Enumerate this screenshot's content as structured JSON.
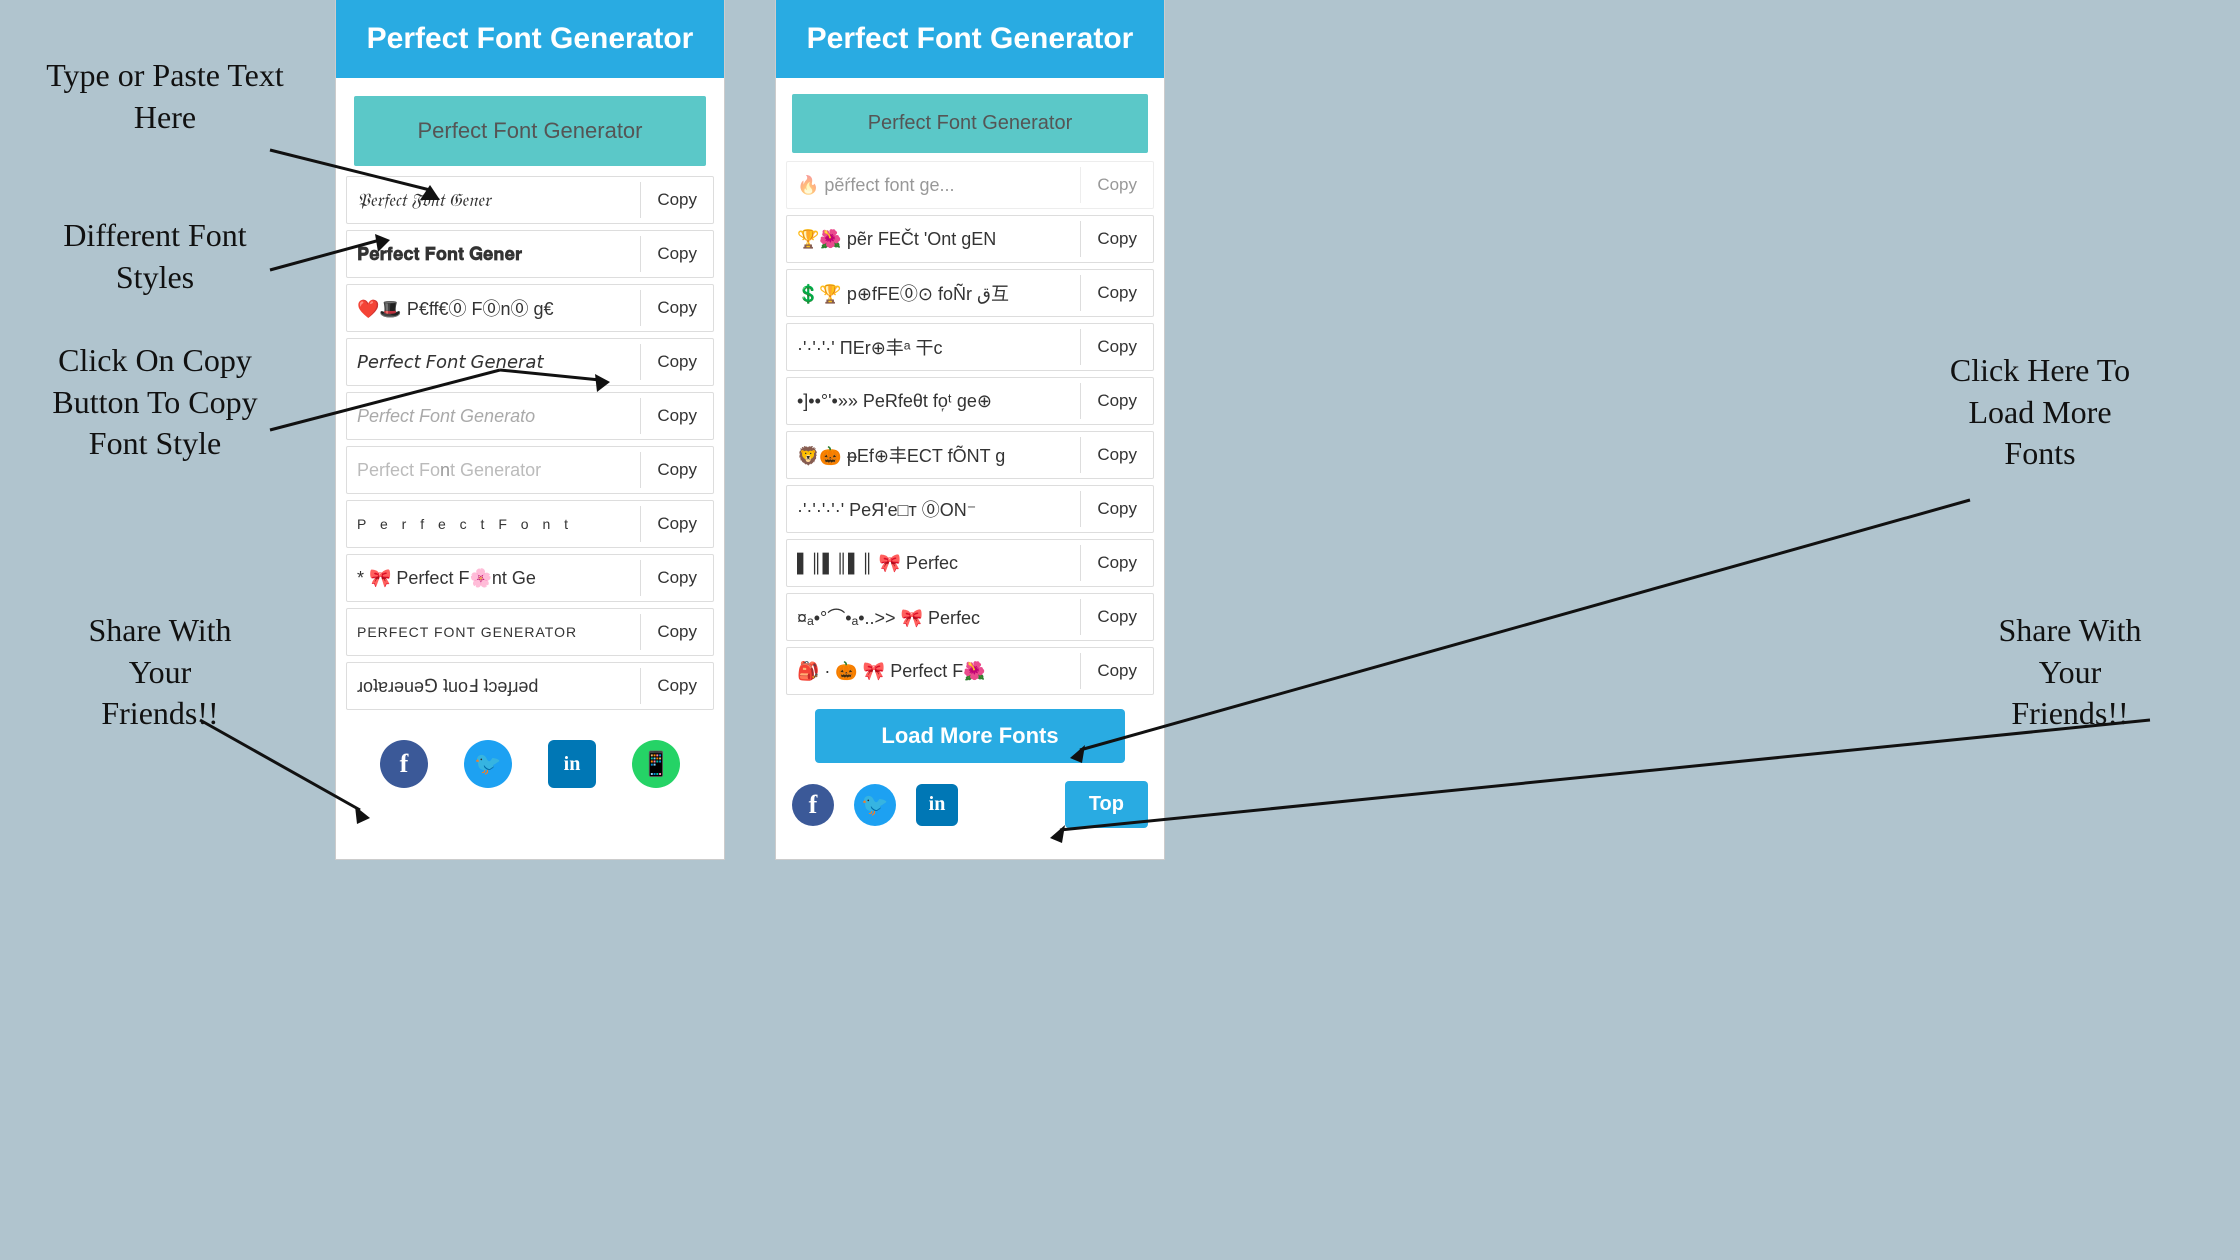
{
  "annotations": {
    "type_paste": "Type or Paste Text\nHere",
    "diff_fonts": "Different Font\nStyles",
    "click_copy": "Click On Copy\nButton To Copy\nFont Style",
    "share": "Share With\nYour\nFriends!!",
    "load_more": "Click Here To\nLoad More\nFonts",
    "share2": "Share With\nYour\nFriends!!"
  },
  "left_panel": {
    "header": "Perfect Font Generator",
    "input_placeholder": "Perfect Font Generator",
    "fonts": [
      {
        "text": "𝔓𝔢𝔯𝔣𝔢𝔠𝔱 𝔉𝔬𝔫𝔱 𝔊𝔢𝔫𝔢𝔯𝔞𝔱𝔬𝔯",
        "copy": "Copy",
        "style": ""
      },
      {
        "text": "𝐏𝐞𝐫𝐟𝐞𝐜𝐭 𝐅𝐨𝐧𝐭 𝐆𝐞𝐧𝐞𝐫𝐚𝐭𝐨𝐫",
        "copy": "Copy",
        "style": ""
      },
      {
        "text": "❤️🎩 P€ff€⓪ F⓪n⓪ g€",
        "copy": "Copy",
        "style": ""
      },
      {
        "text": "𝘗𝘦𝘳𝘧𝘦𝘤𝘵 𝘍𝘰𝘯𝘵 𝘎𝘦𝘯𝘦𝘳𝘢𝘵",
        "copy": "Copy",
        "style": ""
      },
      {
        "text": "𝘗𝘦𝘳𝘧𝘦𝘤𝘵 𝘍𝘰𝘯𝘵 𝘎𝘦𝘯𝘦𝘳𝘢𝘵𝘰",
        "copy": "Copy",
        "style": ""
      },
      {
        "text": "Perfect Font Generator",
        "copy": "Copy",
        "style": "faded"
      },
      {
        "text": "P  e  r  f  e  c  t     F  o  n  t",
        "copy": "Copy",
        "style": "mono"
      },
      {
        "text": "* 🎀 Perfect F🌸nt Ge",
        "copy": "Copy",
        "style": ""
      },
      {
        "text": "PERFECT FONT GENERATOR",
        "copy": "Copy",
        "style": "upper"
      },
      {
        "text": "ɹoʇɐɹǝuǝ⅁ ʇuoℲ ʇɔǝɟɹǝd",
        "copy": "Copy",
        "style": "flip"
      }
    ]
  },
  "right_panel": {
    "header": "Perfect Font Generator",
    "input_placeholder": "Perfect Font Generator",
    "fonts": [
      {
        "text": "🏆🌺 pẽr FEČt 'Ont gEN",
        "copy": "Copy"
      },
      {
        "text": "💲🏆 p⊕fFE⓪⊙ foÑr ق互",
        "copy": "Copy"
      },
      {
        "text": "·'·'·'·' ΠEr⊕丰ᵃ 干c",
        "copy": "Copy"
      },
      {
        "text": "•]••°'•»» PeRfeθt fo᷊ᵗ ge⊕",
        "copy": "Copy"
      },
      {
        "text": "🦁🎃 ᵽEf⊕丰ECT fÕNT g",
        "copy": "Copy"
      },
      {
        "text": "·'·'·'·'·' PeЯ'e□ᴛ ⓪ON⁻",
        "copy": "Copy"
      },
      {
        "text": "▌║▌║▌║ 🎀 Perfec",
        "copy": "Copy"
      },
      {
        "text": "¤ₐ•°⌒•ₐ•..>>  🎀  Perfec",
        "copy": "Copy"
      },
      {
        "text": "🎒 · 🎃 🎀 Perfect F🌺",
        "copy": "Copy"
      }
    ],
    "load_more": "Load More Fonts",
    "top_btn": "Top"
  },
  "social": {
    "facebook": "f",
    "twitter": "🐦",
    "linkedin": "in",
    "whatsapp": "w"
  }
}
